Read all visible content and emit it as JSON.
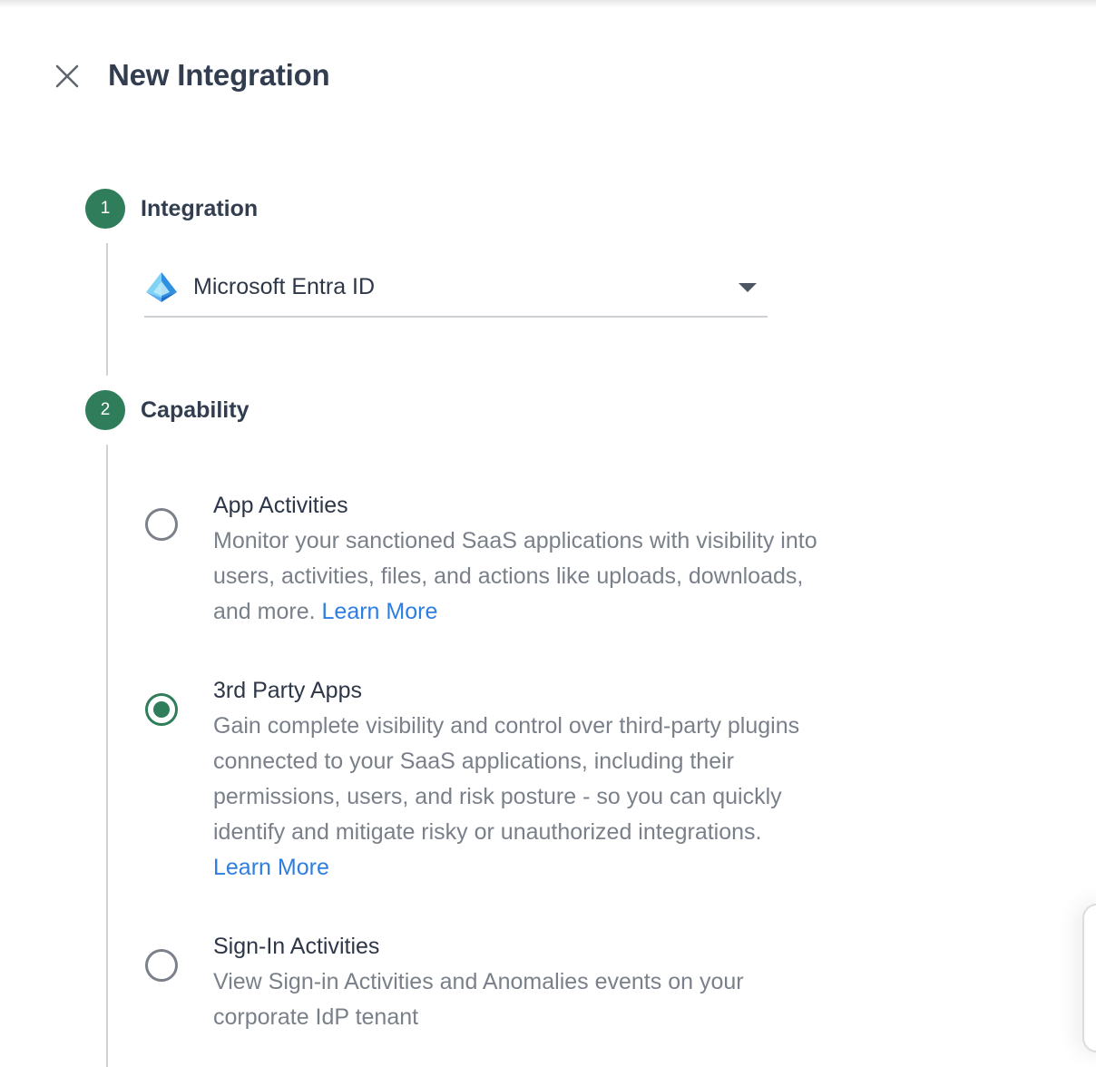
{
  "header": {
    "title": "New Integration",
    "close_icon": "close-icon"
  },
  "steps": [
    {
      "number": "1",
      "label": "Integration"
    },
    {
      "number": "2",
      "label": "Capability"
    }
  ],
  "integration_select": {
    "value": "Microsoft Entra ID",
    "icon": "microsoft-entra-id-logo",
    "caret_icon": "caret-down-icon"
  },
  "capabilities": [
    {
      "title": "App Activities",
      "description": "Monitor your sanctioned SaaS applications with visibility into users, activities, files, and actions like uploads, downloads, and more.",
      "link": "Learn More",
      "selected": false
    },
    {
      "title": "3rd Party Apps",
      "description": "Gain complete visibility and control over third-party plugins connected to your SaaS applications, including their permissions, users, and risk posture - so you can quickly identify and mitigate risky or unauthorized integrations.",
      "link": "Learn More",
      "selected": true
    },
    {
      "title": "Sign-In Activities",
      "description": "View Sign-in Activities and Anomalies events on your corporate IdP tenant",
      "selected": false
    }
  ],
  "colors": {
    "accent": "#2f7d5a",
    "link": "#2e7de1",
    "title_text": "#323e50",
    "muted_text": "#7a808a"
  }
}
